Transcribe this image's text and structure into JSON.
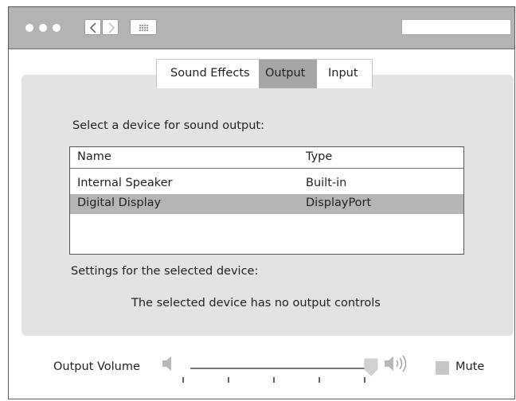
{
  "window": {
    "search": {
      "placeholder": ""
    }
  },
  "tabs": [
    {
      "label": "Sound Effects",
      "selected": false
    },
    {
      "label": "Output",
      "selected": true
    },
    {
      "label": "Input",
      "selected": false
    }
  ],
  "output": {
    "select_prompt": "Select a device for sound output:",
    "table": {
      "columns": [
        "Name",
        "Type"
      ],
      "rows": [
        {
          "name": "Internal Speaker",
          "type": "Built-in",
          "selected": false
        },
        {
          "name": "Digital Display",
          "type": "DisplayPort",
          "selected": true
        }
      ]
    },
    "settings_label": "Settings for the selected device:",
    "no_controls_message": "The selected device has no output controls"
  },
  "volume": {
    "label": "Output Volume",
    "level": 1.0,
    "mute_label": "Mute",
    "muted": false
  },
  "icons": {
    "back": "chevron-left-icon",
    "forward": "chevron-right-icon",
    "grid": "grid-icon",
    "volume_low": "speaker-low-icon",
    "volume_high": "speaker-high-icon"
  }
}
